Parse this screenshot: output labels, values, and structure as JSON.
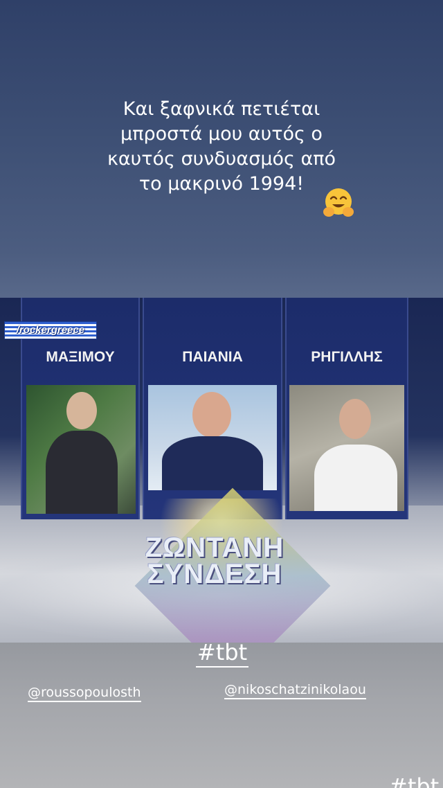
{
  "story": {
    "caption_lines": [
      "Και ξαφνικά πετιέται",
      "μπροστά μου αυτός ο",
      "καυτός συνδυασμός από",
      "το μακρινό 1994!"
    ],
    "emoji": "hugging-face-emoji",
    "hashtag": "#tbt",
    "hashtag_partial": "#tbt",
    "mentions": [
      "@roussopoulosth",
      "@nikoschatzinikolaou"
    ]
  },
  "tv_screen": {
    "watermark": "/rockergreece",
    "columns": [
      "ΜΑΞΙΜΟΥ",
      "ΠΑΙΑΝΙΑ",
      "ΡΗΓΙΛΛΗΣ"
    ],
    "live_lines": [
      "ΖΩΝΤΑΝΗ",
      "ΣΥΝΔΕΣΗ"
    ]
  },
  "colors": {
    "background_top": "#2f4068",
    "background_bottom": "#a4a6ab",
    "text": "#ffffff",
    "broadcast_blue": "#24357a"
  }
}
